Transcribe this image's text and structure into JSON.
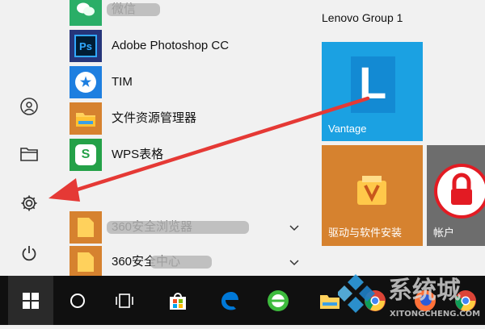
{
  "apps": [
    {
      "label": "微信",
      "icon": "wechat-icon"
    },
    {
      "label": "Adobe Photoshop CC",
      "icon": "photoshop-icon"
    },
    {
      "label": "TIM",
      "icon": "tim-icon"
    },
    {
      "label": "文件资源管理器",
      "icon": "folder-icon"
    },
    {
      "label": "WPS表格",
      "icon": "wps-spreadsheet-icon"
    },
    {
      "label": "360安全浏览器",
      "icon": "folder-icon"
    },
    {
      "label": "360安全中心",
      "icon": "folder-icon"
    }
  ],
  "rail": [
    {
      "name": "user-account",
      "icon": "user-icon"
    },
    {
      "name": "documents",
      "icon": "file-explorer-icon"
    },
    {
      "name": "settings",
      "icon": "gear-icon"
    },
    {
      "name": "power",
      "icon": "power-icon"
    }
  ],
  "tiles": {
    "group_title": "Lenovo Group 1",
    "vantage_label": "Vantage",
    "driver_label": "驱动与软件安装",
    "account_label": "帐户",
    "vantage_color": "#1ba1e2",
    "driver_color": "#d6822f",
    "account_color": "#6d6d6d"
  },
  "taskbar": [
    {
      "name": "start",
      "icon": "windows-logo-icon"
    },
    {
      "name": "search",
      "icon": "cortana-icon"
    },
    {
      "name": "task-view",
      "icon": "task-view-icon"
    },
    {
      "name": "store",
      "icon": "store-icon"
    },
    {
      "name": "edge",
      "icon": "edge-icon"
    },
    {
      "name": "360-browser",
      "icon": "360-browser-icon"
    },
    {
      "name": "file-explorer",
      "icon": "folder-icon"
    },
    {
      "name": "chrome",
      "icon": "chrome-icon"
    },
    {
      "name": "firefox",
      "icon": "firefox-icon"
    },
    {
      "name": "chrome-2",
      "icon": "chrome-icon"
    }
  ],
  "watermark": {
    "text": "系统城",
    "domain": "XITONGCHENG.COM"
  },
  "annotation": {
    "color": "#e53935"
  }
}
